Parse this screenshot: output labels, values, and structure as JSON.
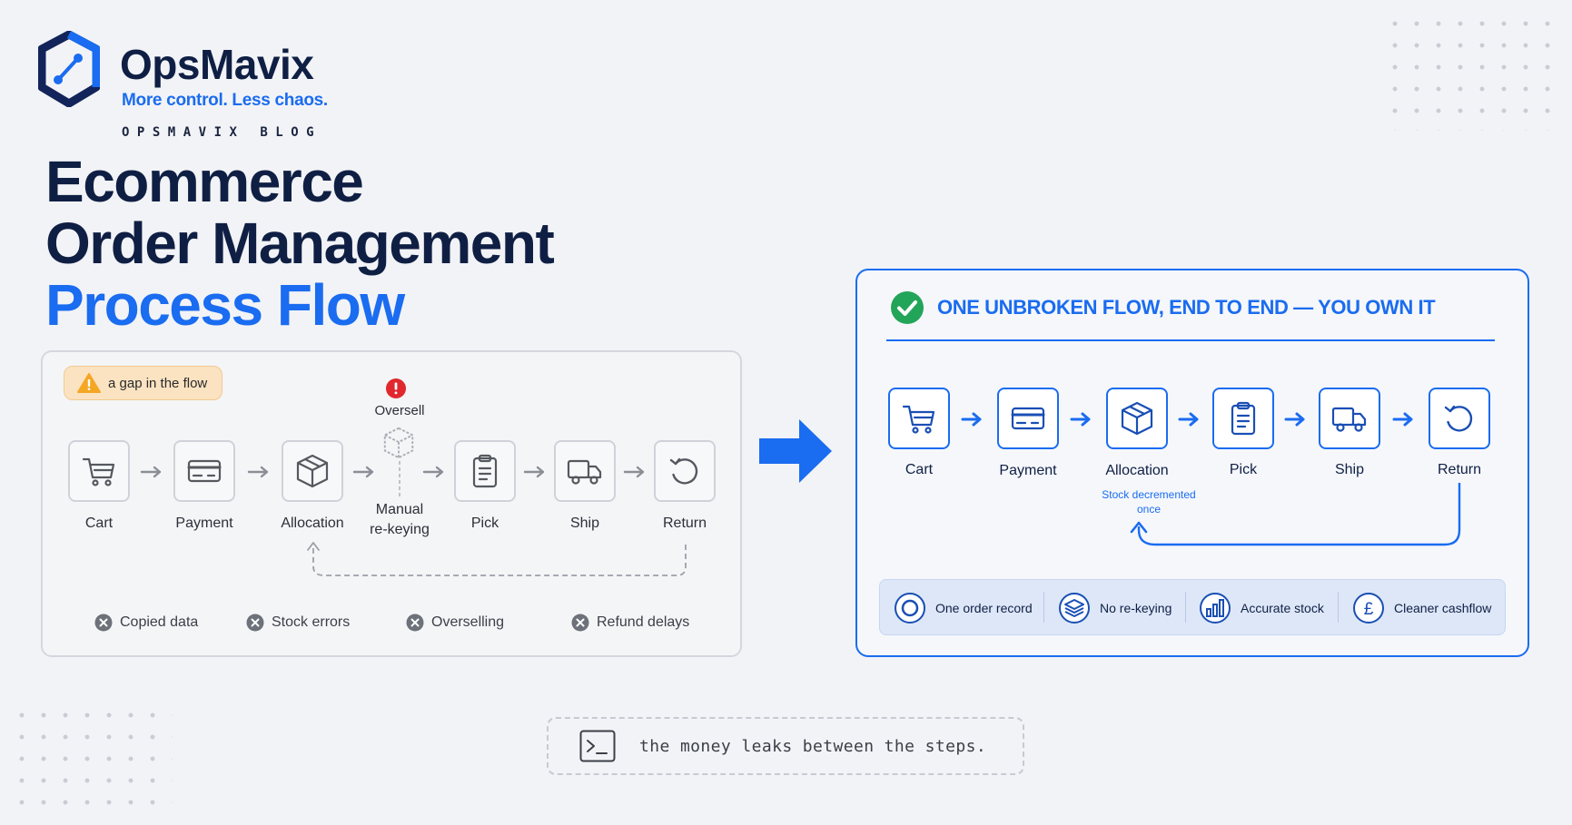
{
  "brand": {
    "name": "OpsMavix",
    "tagline": "More control. Less chaos.",
    "blog_label": "OPSMAVIX BLOG"
  },
  "title": {
    "line1": "Ecommerce",
    "line2": "Order Management",
    "line3": "Process Flow"
  },
  "left_panel": {
    "badge": "a gap in the flow",
    "steps": [
      {
        "label": "Cart",
        "icon": "cart-icon"
      },
      {
        "label": "Payment",
        "icon": "card-icon"
      },
      {
        "label": "Allocation",
        "icon": "box-icon"
      },
      {
        "label": "Pick",
        "icon": "clipboard-icon"
      },
      {
        "label": "Ship",
        "icon": "truck-icon"
      },
      {
        "label": "Return",
        "icon": "return-icon"
      }
    ],
    "oversell_label": "Oversell",
    "manual_label_1": "Manual",
    "manual_label_2": "re-keying",
    "problems": [
      "Copied data",
      "Stock errors",
      "Overselling",
      "Refund delays"
    ]
  },
  "right_panel": {
    "heading": "ONE UNBROKEN FLOW, END TO END — YOU OWN IT",
    "steps": [
      {
        "label": "Cart",
        "icon": "cart-icon"
      },
      {
        "label": "Payment",
        "icon": "card-icon"
      },
      {
        "label": "Allocation",
        "icon": "box-icon"
      },
      {
        "label": "Pick",
        "icon": "clipboard-icon"
      },
      {
        "label": "Ship",
        "icon": "truck-icon"
      },
      {
        "label": "Return",
        "icon": "return-icon"
      }
    ],
    "stock_note_1": "Stock decremented",
    "stock_note_2": "once",
    "benefits": [
      {
        "label": "One order record",
        "icon": "ring-icon"
      },
      {
        "label": "No re-keying",
        "icon": "layers-icon"
      },
      {
        "label": "Accurate stock",
        "icon": "bar-chart-icon"
      },
      {
        "label": "Cleaner cashflow",
        "icon": "pound-icon"
      }
    ]
  },
  "terminal": {
    "text": "the money leaks between the steps."
  },
  "colors": {
    "navy": "#0f1f44",
    "blue": "#1a6cf0",
    "warn": "#f5a623",
    "error": "#e0282e",
    "success": "#22a559"
  }
}
